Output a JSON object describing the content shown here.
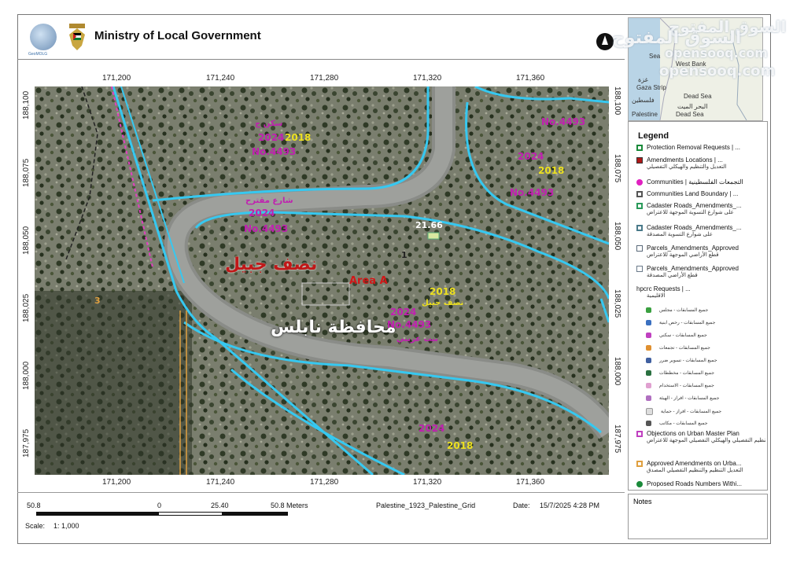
{
  "header": {
    "title": "Ministry of Local Government",
    "logo_caption": "GeoMOLG"
  },
  "watermark": {
    "line1": "السوق المفتوح",
    "line2": "opensooq.com"
  },
  "inset": {
    "labels": [
      "West Bank",
      "غزة",
      "Gaza Strip",
      "Dead Sea",
      "البحر الميت",
      "Palestine",
      "Dead Sea",
      "Sea",
      "فلسطين"
    ]
  },
  "axis": {
    "top_ticks": [
      "171,200",
      "171,240",
      "171,280",
      "171,320",
      "171,360"
    ],
    "bottom_ticks": [
      "171,200",
      "171,240",
      "171,280",
      "171,320",
      "171,360"
    ],
    "left_ticks": [
      "188,100",
      "188,075",
      "188,050",
      "188,025",
      "188,000",
      "187,975"
    ],
    "right_ticks": [
      "188,100",
      "188,075",
      "188,050",
      "188,025",
      "188,000",
      "187,975"
    ]
  },
  "map_labels": {
    "area": "Area A",
    "place": "نصف جبيل",
    "governorate": "محافظة نابلس",
    "parcel_a": "No.4493",
    "parcel_b": "No.4493",
    "parcel_c": "No.4493",
    "parcel_d": "No.4493",
    "parcel_e": "No.4493",
    "year_a": "2024",
    "year_b": "2024",
    "year_c": "2024",
    "year_d": "2024",
    "year_e": "2024",
    "year_f": "2018",
    "year_g": "2018",
    "year_h": "2018",
    "year_i": "2018",
    "road_num": "21.66",
    "num_1": "1",
    "num_3": "3",
    "label_a": "سكن ج",
    "label_b": "نصف جبيل",
    "label_c": "بيت عريبي",
    "label_d": "شارع مقترح"
  },
  "legend": {
    "title": "Legend",
    "items": [
      {
        "label": "Protection Removal Requests | ...",
        "sub": "",
        "color": "#1a8a3a"
      },
      {
        "label": "Amendments Locations | ...",
        "sub": "التعديل والتنظيم والهيكلي التفصيلي",
        "color": "#b01818"
      },
      {
        "label": "Communities | التجمعات الفلسطينية",
        "sub": "",
        "color": "#e020c0"
      },
      {
        "label": "Communities Land Boundary | ...",
        "sub": "",
        "color": "#555555"
      },
      {
        "label": "Cadaster Roads_Amendments_...",
        "sub": "على شوارع التسوية الموجهة للاعتراض",
        "color": "#2a9a5a"
      },
      {
        "label": "Cadaster Roads_Amendments_...",
        "sub": "على شوارع التسوية المصدقة",
        "color": "#4a7a8a"
      },
      {
        "label": "Parcels_Amendments_Approved",
        "sub": "قطع الأراضي الموجهة للاعتراض",
        "color": "#5a6a7a"
      },
      {
        "label": "Parcels_Amendments_Approved",
        "sub": "قطع الأراضي المصدقة",
        "color": "#6a7a8a"
      },
      {
        "label": "hpcrc Requests | ...",
        "sub": "الاقليمية",
        "color": "#ffffff"
      }
    ],
    "subitems": [
      {
        "label": "جميع المسابقات - مجلس",
        "color": "#3aa040"
      },
      {
        "label": "جميع المسابقات - رخص ابنية",
        "color": "#3a70c0"
      },
      {
        "label": "جميع المسابقات - سكني",
        "color": "#c040c0"
      },
      {
        "label": "جميع المسابقات - تجمعات",
        "color": "#e09030"
      },
      {
        "label": "جميع المسابقات - تسوير ضرر",
        "color": "#4060a0"
      },
      {
        "label": "جميع المسابقات - مخططات",
        "color": "#2a7040"
      },
      {
        "label": "جميع المسابقات - الاستخدام",
        "color": "#e0a0d0"
      },
      {
        "label": "جميع المسابقات - افراز - الهيئة",
        "color": "#b070c0"
      },
      {
        "label": "جميع المسابقات - افراز - حماية",
        "color": "#dddddd"
      },
      {
        "label": "جميع المسابقات - مكاتب",
        "color": "#555555"
      }
    ],
    "bottom_items": [
      {
        "label": "Objections on Urban Master Plan",
        "sub": "تخطيط والتنظيم التفصيلي والهيكلي التفصيلي الموجهة للاعتراض",
        "color": "#c040c0"
      },
      {
        "label": "Approved Amendments on Urba...",
        "sub": "التعديل التنظيم والتنظيم التفصيلي المصدق",
        "color": "#e0a040"
      },
      {
        "label": "Proposed Roads Numbers Withi...",
        "sub": "",
        "color": "#1a8a3a"
      }
    ]
  },
  "notes": {
    "title": "Notes"
  },
  "footer": {
    "scale_left": "50.8",
    "scale_zero": "0",
    "scale_mid": "25.40",
    "scale_right": "50.8 Meters",
    "grid": "Palestine_1923_Palestine_Grid",
    "date_label": "Date:",
    "date_value": "15/7/2025 4:28 PM",
    "scale_label": "Scale:",
    "scale_value": "1: 1,000"
  }
}
